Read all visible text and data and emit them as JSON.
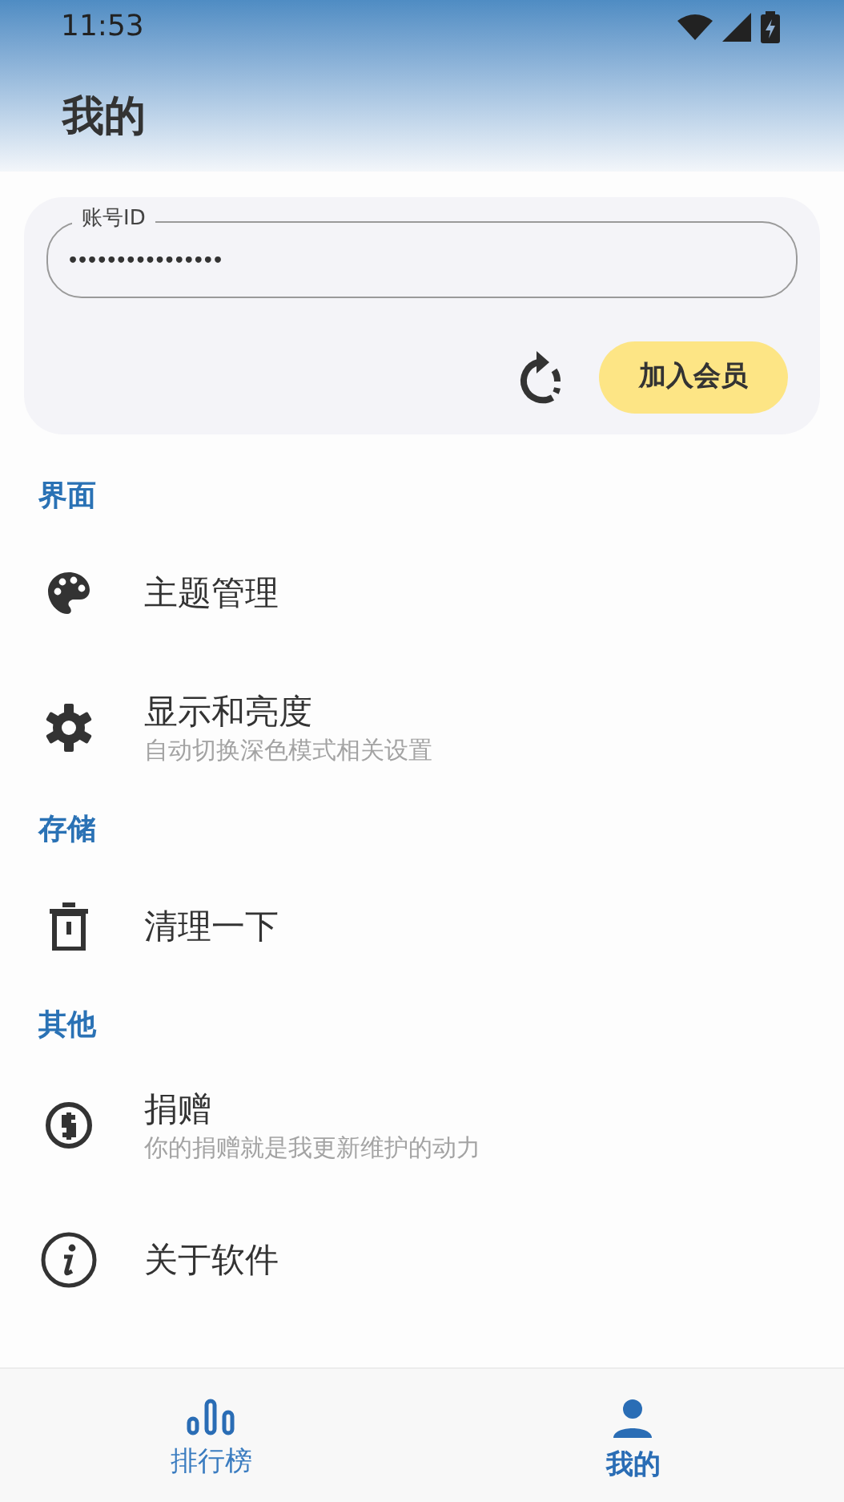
{
  "status_bar": {
    "time": "11:53"
  },
  "header": {
    "title": "我的"
  },
  "account": {
    "label": "账号ID",
    "value": "••••••••••••••••",
    "join_button": "加入会员"
  },
  "sections": [
    {
      "title": "界面",
      "items": [
        {
          "title": "主题管理"
        },
        {
          "title": "显示和亮度",
          "subtitle": "自动切换深色模式相关设置"
        }
      ]
    },
    {
      "title": "存储",
      "items": [
        {
          "title": "清理一下"
        }
      ]
    },
    {
      "title": "其他",
      "items": [
        {
          "title": "捐赠",
          "subtitle": "你的捐赠就是我更新维护的动力"
        },
        {
          "title": "关于软件"
        }
      ]
    }
  ],
  "bottom_nav": [
    {
      "label": "排行榜",
      "selected": false
    },
    {
      "label": "我的",
      "selected": true
    }
  ]
}
